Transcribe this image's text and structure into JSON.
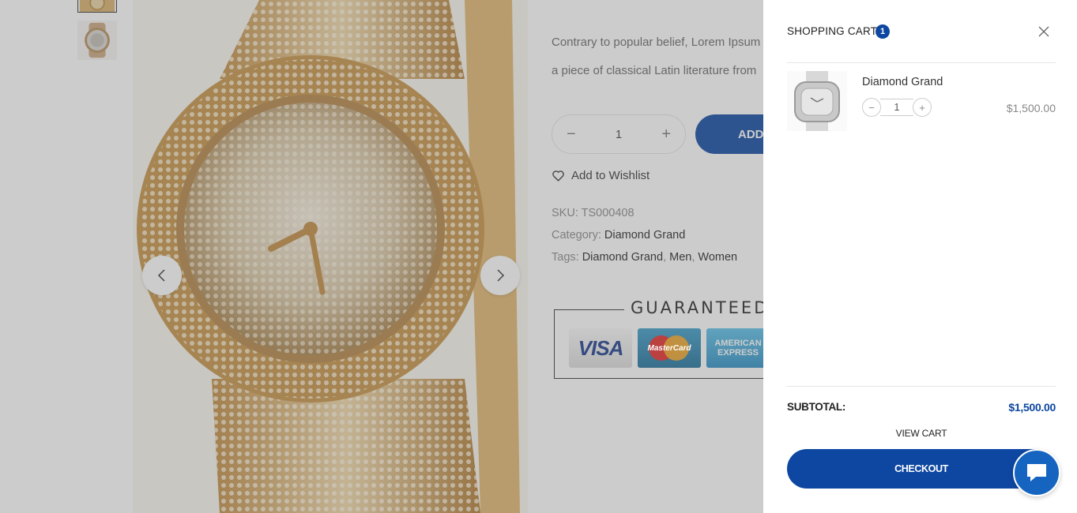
{
  "product": {
    "description_line1": "Contrary to popular belief, Lorem Ipsum",
    "description_line2": "a piece of classical Latin literature from",
    "quantity": "1",
    "add_to_cart_label": "ADD",
    "wishlist_label": "Add to Wishlist",
    "sku_label": "SKU:",
    "sku_value": "TS000408",
    "category_label": "Category:",
    "category_value": "Diamond Grand",
    "tags_label": "Tags:",
    "tags": [
      "Diamond Grand",
      "Men",
      "Women"
    ],
    "guarantee_title": "GUARANTEED S",
    "payment_cards": [
      "VISA",
      "MasterCard",
      "AMERICAN EXPRESS"
    ]
  },
  "cart": {
    "title": "SHOPPING CART",
    "count": "1",
    "items": [
      {
        "name": "Diamond Grand",
        "quantity": "1",
        "price": "$1,500.00"
      }
    ],
    "subtotal_label": "SUBTOTAL:",
    "subtotal_value": "$1,500.00",
    "view_cart_label": "VIEW CART",
    "checkout_label": "CHECKOUT"
  },
  "icons": {
    "close": "close-icon",
    "wishlist": "heart-icon",
    "chat": "chat-bubble-icon",
    "prev": "chevron-left-icon",
    "next": "chevron-right-icon"
  },
  "colors": {
    "accent": "#0d47a1",
    "chat": "#1565c0"
  }
}
